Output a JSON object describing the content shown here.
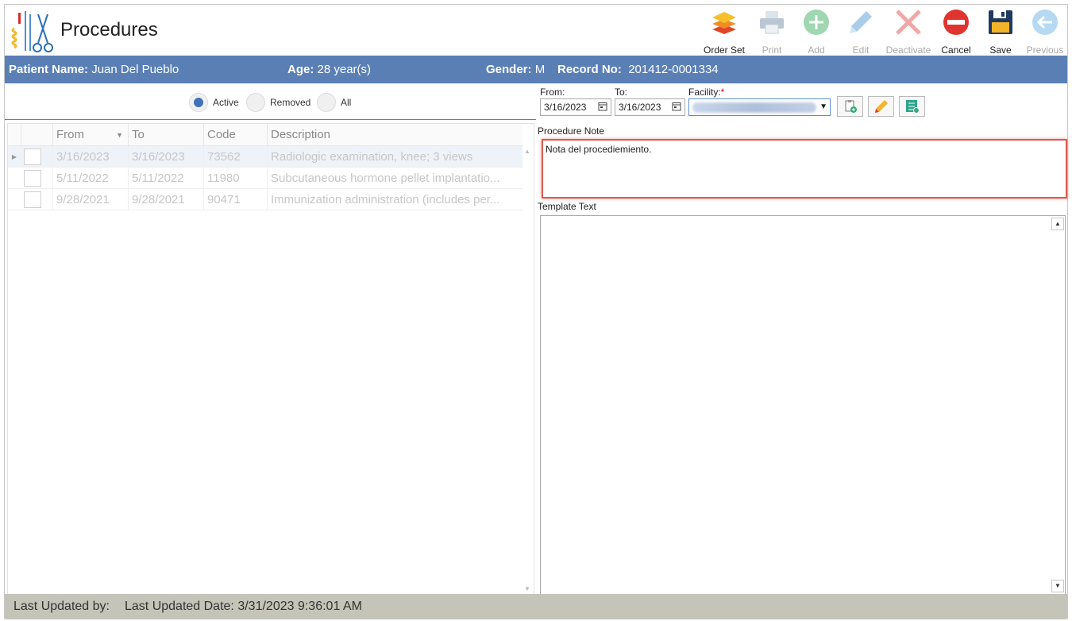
{
  "header": {
    "title": "Procedures",
    "logo_icon": "surgical-instruments-icon"
  },
  "toolbar": {
    "order_set": "Order Set",
    "print": "Print",
    "add": "Add",
    "edit": "Edit",
    "deactivate": "Deactivate",
    "cancel": "Cancel",
    "save": "Save",
    "previous": "Previous"
  },
  "patient": {
    "name_label": "Patient Name:",
    "name": "Juan Del Pueblo",
    "age_label": "Age:",
    "age": "28 year(s)",
    "gender_label": "Gender:",
    "gender": "M",
    "record_label": "Record No:",
    "record": "201412-0001334"
  },
  "filters": {
    "active": "Active",
    "removed": "Removed",
    "all": "All",
    "selected": "Active"
  },
  "grid": {
    "columns": [
      "From",
      "To",
      "Code",
      "Description"
    ],
    "rows": [
      {
        "from": "3/16/2023",
        "to": "3/16/2023",
        "code": "73562",
        "description": "Radiologic examination, knee; 3 views"
      },
      {
        "from": "5/11/2022",
        "to": "5/11/2022",
        "code": "11980",
        "description": "Subcutaneous hormone pellet implantatio..."
      },
      {
        "from": "9/28/2021",
        "to": "9/28/2021",
        "code": "90471",
        "description": "Immunization administration (includes per..."
      }
    ]
  },
  "form": {
    "from_label": "From:",
    "from_value": "3/16/2023",
    "to_label": "To:",
    "to_value": "3/16/2023",
    "facility_label": "Facility:",
    "facility_required": "*",
    "procedure_note_label": "Procedure Note",
    "procedure_note_value": "Nota del procediemiento.",
    "template_text_label": "Template Text"
  },
  "footer": {
    "updated_by_label": "Last Updated by:",
    "updated_date_label": "Last Updated Date:",
    "updated_date": "3/31/2023 9:36:01 AM"
  },
  "colors": {
    "accent": "#5a7fb5",
    "highlight": "#d85c50",
    "footer": "#c4c4b8"
  }
}
